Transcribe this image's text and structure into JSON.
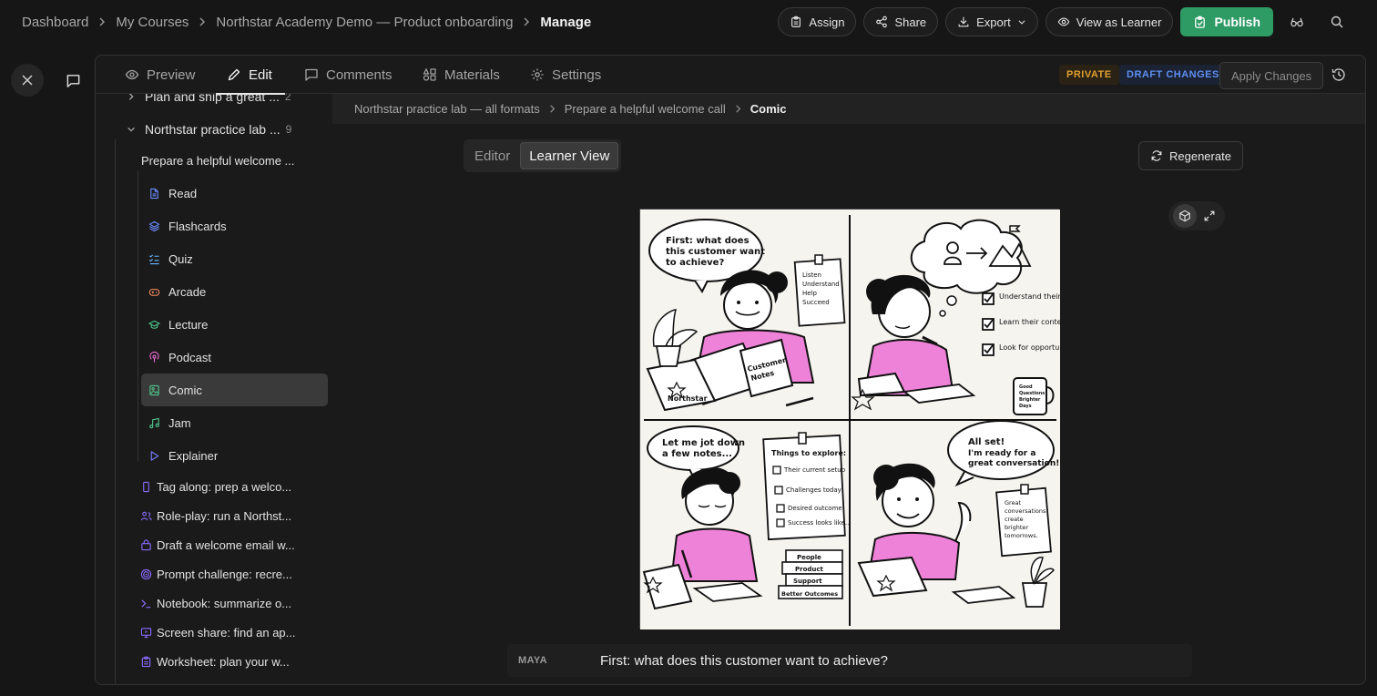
{
  "topbar": {
    "breadcrumbs": [
      "Dashboard",
      "My Courses",
      "Northstar Academy Demo — Product onboarding"
    ],
    "current": "Manage",
    "assign_label": "Assign",
    "share_label": "Share",
    "export_label": "Export",
    "view_as_learner_label": "View as Learner",
    "publish_label": "Publish",
    "accent_color": "#2e9a64"
  },
  "tabs": [
    "Preview",
    "Edit",
    "Comments",
    "Materials",
    "Settings"
  ],
  "active_tab": "Edit",
  "status": {
    "private": "PRIVATE",
    "draft": "DRAFT CHANGES",
    "apply_label": "Apply Changes"
  },
  "sidebar": {
    "module_prev": {
      "label": "Plan and ship a great ...",
      "count": "2"
    },
    "module": {
      "label": "Northstar practice lab ...",
      "count": "9"
    },
    "lesson": "Prepare a helpful welcome ...",
    "formats": [
      {
        "label": "Read",
        "icon": "document-icon",
        "color": "#6b8cff"
      },
      {
        "label": "Flashcards",
        "icon": "layers-icon",
        "color": "#6b8cff"
      },
      {
        "label": "Quiz",
        "icon": "checklist-icon",
        "color": "#6bb6ff"
      },
      {
        "label": "Arcade",
        "icon": "gamepad-icon",
        "color": "#f08a5d"
      },
      {
        "label": "Lecture",
        "icon": "graduation-cap-icon",
        "color": "#4fc38a"
      },
      {
        "label": "Podcast",
        "icon": "podcast-icon",
        "color": "#e66bd0"
      },
      {
        "label": "Comic",
        "icon": "image-icon",
        "color": "#4fc38a"
      },
      {
        "label": "Jam",
        "icon": "music-icon",
        "color": "#4fc38a"
      },
      {
        "label": "Explainer",
        "icon": "play-icon",
        "color": "#7b7bff"
      }
    ],
    "selected": "Comic",
    "activities": [
      {
        "label": "Tag along: prep a welco...",
        "icon": "phone-icon",
        "color": "#8b6bff"
      },
      {
        "label": "Role-play: run a Northst...",
        "icon": "users-icon",
        "color": "#8b6bff"
      },
      {
        "label": "Draft a welcome email w...",
        "icon": "bag-icon",
        "color": "#8b6bff"
      },
      {
        "label": "Prompt challenge: recre...",
        "icon": "target-icon",
        "color": "#8b6bff"
      },
      {
        "label": "Notebook: summarize o...",
        "icon": "terminal-icon",
        "color": "#8b6bff"
      },
      {
        "label": "Screen share: find an ap...",
        "icon": "monitor-icon",
        "color": "#8b6bff"
      },
      {
        "label": "Worksheet: plan your w...",
        "icon": "clipboard-icon",
        "color": "#8b6bff"
      }
    ]
  },
  "content_breadcrumbs": [
    "Northstar practice lab — all formats",
    "Prepare a helpful welcome call"
  ],
  "content_current": "Comic",
  "view_toggle": {
    "editor": "Editor",
    "learner": "Learner View",
    "active": "Learner View"
  },
  "regenerate_label": "Regenerate",
  "comic": {
    "panel1_bubble": [
      "First: what does",
      "this customer want",
      "to achieve?"
    ],
    "panel1_note": [
      "Listen",
      "Understand",
      "Help",
      "Succeed"
    ],
    "panel1_notebook": [
      "Customer",
      "Notes"
    ],
    "panel1_laptop": "Northstar",
    "panel2_list": [
      "Understand their goals",
      "Learn their context",
      "Look for opportunities to help"
    ],
    "panel2_mug": [
      "Good",
      "Questions",
      "Brighter",
      "Days"
    ],
    "panel3_bubble": [
      "Let me jot down",
      "a few notes..."
    ],
    "panel3_title": "Things to explore:",
    "panel3_list": [
      "Their current setup",
      "Challenges today",
      "Desired outcome",
      "Success looks like..."
    ],
    "panel3_books": [
      "People",
      "Product",
      "Support",
      "Better Outcomes"
    ],
    "panel4_bubble": [
      "All set!",
      "I'm ready for a",
      "great conversation!"
    ],
    "panel4_note": [
      "Great",
      "conversations",
      "create",
      "brighter",
      "tomorrows."
    ]
  },
  "caption": {
    "speaker": "MAYA",
    "line": "First: what does this customer want to achieve?"
  }
}
